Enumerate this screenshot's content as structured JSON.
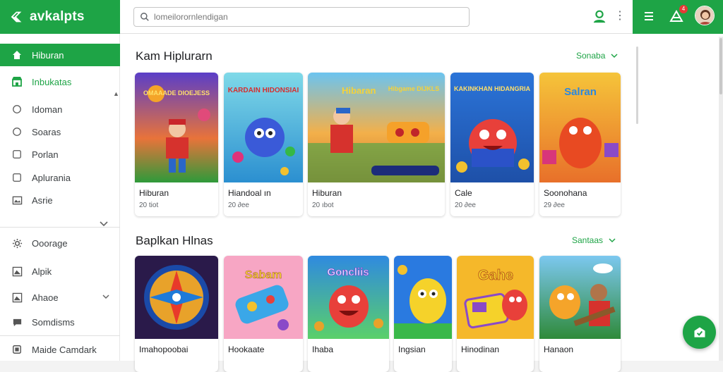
{
  "brand": {
    "name": "avkalpts"
  },
  "search": {
    "placeholder": "lomeilorornlendigan"
  },
  "header": {
    "cart_badge": "4"
  },
  "sidebar": {
    "items": [
      {
        "label": "Hiburan",
        "icon": "home-icon",
        "state": "active"
      },
      {
        "label": "Inbukatas",
        "icon": "store-icon",
        "state": "green"
      },
      {
        "label": "Idoman",
        "icon": "circle-icon"
      },
      {
        "label": "Soaras",
        "icon": "circle-icon"
      },
      {
        "label": "Porlan",
        "icon": "square-icon"
      },
      {
        "label": "Aplurania",
        "icon": "square-icon"
      },
      {
        "label": "Asrie",
        "icon": "picture-icon"
      },
      {
        "label": "Ooorage",
        "icon": "gear-icon"
      },
      {
        "label": "Alpik",
        "icon": "picture-icon"
      },
      {
        "label": "Ahaoe",
        "icon": "picture-icon",
        "has_chevron": true
      },
      {
        "label": "Somdisms",
        "icon": "chat-icon"
      },
      {
        "label": "Maide Camdark",
        "icon": "square-icon"
      }
    ]
  },
  "sections": [
    {
      "title": "Kam Hiplurarn",
      "see_all": "Sonaba",
      "cards": [
        {
          "thumb_text": "OMAAADE DIOEJESS",
          "title": "Hiburan",
          "meta": "20  tiot"
        },
        {
          "thumb_text": "KARDAIN HIDONSIAI",
          "title": "Hiandoal ın",
          "meta": "20  ∂ee"
        },
        {
          "thumb_text": "Hibaran",
          "thumb_text2": "Hibgame DIJKLS",
          "title": "Hiburan",
          "meta": "20  ıbot"
        },
        {
          "thumb_text": "KAKINKHAN HIDANGRIA",
          "title": "Cale",
          "meta": "20  ∂ee"
        },
        {
          "thumb_text": "Salran",
          "title": "Soonohana",
          "meta": "29  ∂ee"
        }
      ]
    },
    {
      "title": "Baplkan Hlnas",
      "see_all": "Santaas",
      "cards": [
        {
          "thumb_text": "",
          "title": "Imahopoobai",
          "meta": ""
        },
        {
          "thumb_text": "Sabam",
          "title": "Hookaate",
          "meta": ""
        },
        {
          "thumb_text": "Goncliis",
          "title": "Ihaba",
          "meta": ""
        },
        {
          "thumb_text": "",
          "title": "Ingsian",
          "meta": ""
        },
        {
          "thumb_text": "Gahe",
          "title": "Hinodinan",
          "meta": ""
        },
        {
          "thumb_text": "",
          "title": "Hanaon",
          "meta": ""
        }
      ]
    }
  ],
  "colors": {
    "accent": "#1ea446",
    "badge": "#e53935"
  }
}
